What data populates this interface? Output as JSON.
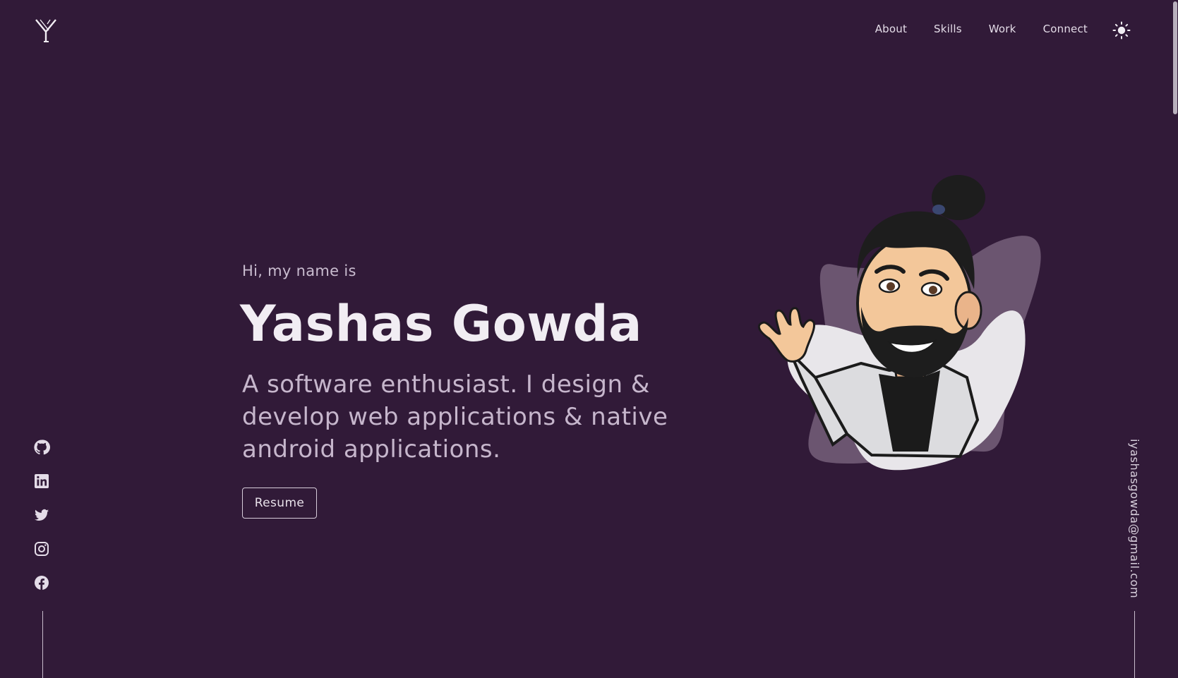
{
  "header": {
    "logo_letter": "Y",
    "nav": [
      "About",
      "Skills",
      "Work",
      "Connect"
    ],
    "theme_icon": "sun-icon"
  },
  "hero": {
    "greeting": "Hi, my name is",
    "name": "Yashas Gowda",
    "tagline": "A software enthusiast. I design & develop web applications & native android applications.",
    "resume_label": "Resume"
  },
  "social": {
    "icons": [
      "github-icon",
      "linkedin-icon",
      "twitter-icon",
      "instagram-icon",
      "facebook-icon"
    ]
  },
  "contact": {
    "email": "iyashasgowda@gmail.com"
  },
  "colors": {
    "background": "#311a38",
    "text": "#f1edf3",
    "muted": "#c6b6cc",
    "blob_dark": "#6b5570",
    "blob_light": "#e8e6ea"
  }
}
